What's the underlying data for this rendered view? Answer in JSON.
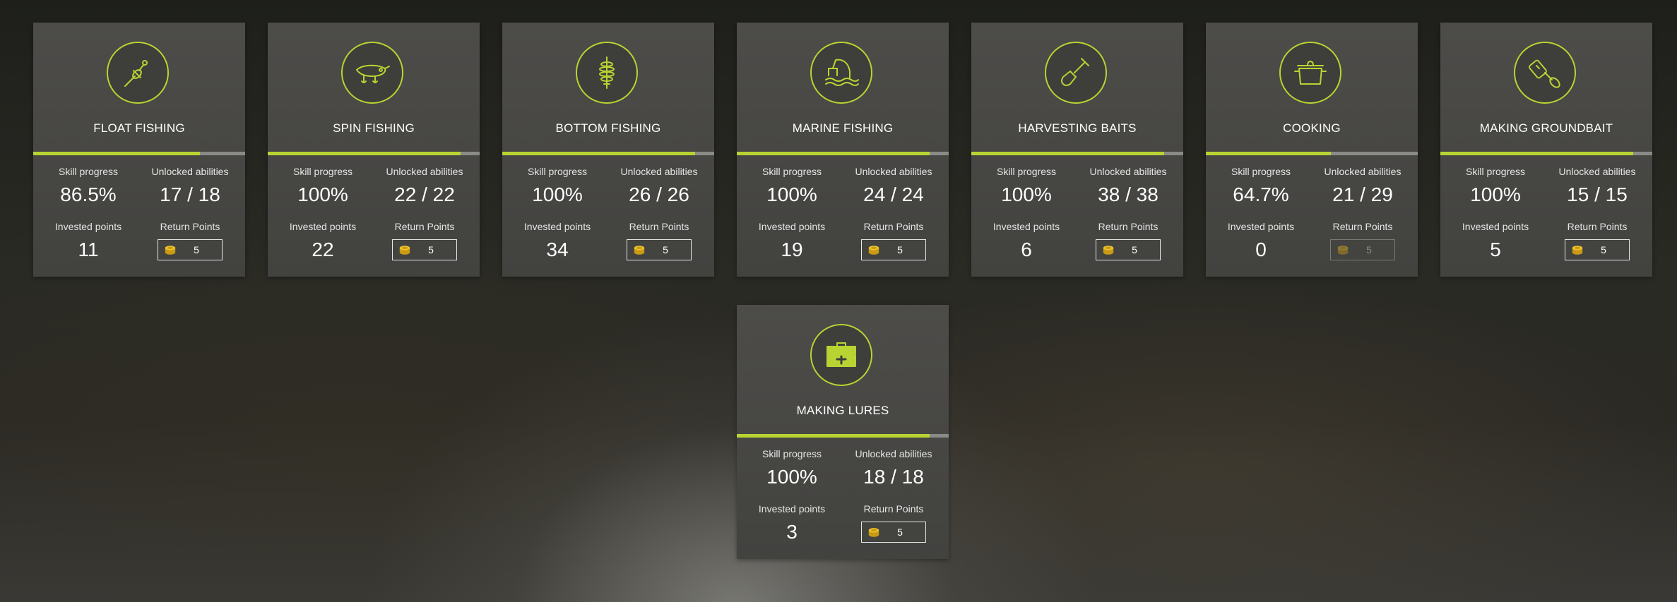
{
  "labels": {
    "skill_progress": "Skill progress",
    "unlocked_abilities": "Unlocked abilities",
    "invested_points": "Invested points",
    "return_points": "Return Points"
  },
  "colors": {
    "accent": "#b8d432",
    "coin": "#e8b820"
  },
  "skills": [
    {
      "title": "FLOAT FISHING",
      "icon": "float-icon",
      "progress": "86.5%",
      "progress_fraction": 0.786,
      "abilities": "17 / 18",
      "invested": "11",
      "return_points": "5",
      "return_enabled": true
    },
    {
      "title": "SPIN FISHING",
      "icon": "lure-icon",
      "progress": "100%",
      "progress_fraction": 0.91,
      "abilities": "22 / 22",
      "invested": "22",
      "return_points": "5",
      "return_enabled": true
    },
    {
      "title": "BOTTOM FISHING",
      "icon": "feeder-icon",
      "progress": "100%",
      "progress_fraction": 0.91,
      "abilities": "26 / 26",
      "invested": "34",
      "return_points": "5",
      "return_enabled": true
    },
    {
      "title": "MARINE FISHING",
      "icon": "marine-icon",
      "progress": "100%",
      "progress_fraction": 0.91,
      "abilities": "24 / 24",
      "invested": "19",
      "return_points": "5",
      "return_enabled": true
    },
    {
      "title": "HARVESTING BAITS",
      "icon": "shovel-icon",
      "progress": "100%",
      "progress_fraction": 0.91,
      "abilities": "38 / 38",
      "invested": "6",
      "return_points": "5",
      "return_enabled": true
    },
    {
      "title": "COOKING",
      "icon": "pot-icon",
      "progress": "64.7%",
      "progress_fraction": 0.59,
      "abilities": "21 / 29",
      "invested": "0",
      "return_points": "5",
      "return_enabled": false
    },
    {
      "title": "MAKING GROUNDBAIT",
      "icon": "mixer-icon",
      "progress": "100%",
      "progress_fraction": 0.91,
      "abilities": "15 / 15",
      "invested": "5",
      "return_points": "5",
      "return_enabled": true
    },
    {
      "title": "MAKING LURES",
      "icon": "toolbox-icon",
      "progress": "100%",
      "progress_fraction": 0.91,
      "abilities": "18 / 18",
      "invested": "3",
      "return_points": "5",
      "return_enabled": true
    }
  ]
}
